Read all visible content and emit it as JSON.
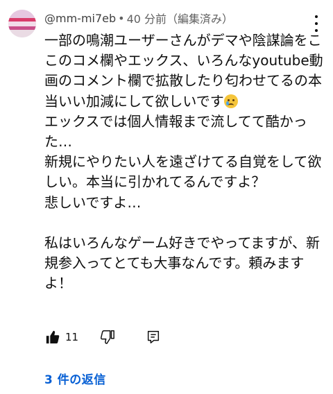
{
  "comment": {
    "handle": "@mm-mi7eb",
    "separator": "•",
    "time": "40 分前（編集済み）",
    "lines": [
      "一部の鳴潮ユーザーさんがデマや陰謀論をこ",
      "このコメ欄やエックス、いろんなyoutube動",
      "画のコメント欄で拡散したり匂わせてるの本",
      "当いい加減にして欲しいです",
      "エックスでは個人情報まで流してて酷かっ",
      "た…",
      "新規にやりたい人を遠ざけてる自覚をして欲",
      "しい。本当に引かれてるんですよ？",
      "悲しいですよ…",
      "",
      "私はいろんなゲーム好きでやってますが、新",
      "規参入ってとても大事なんです。頼みます",
      "よ！"
    ],
    "emoji": "crying-face-emoji"
  },
  "actions": {
    "like_count": "11",
    "icons": [
      "thumbs-up-icon",
      "thumbs-down-icon",
      "reply-icon"
    ]
  },
  "replies": {
    "label": "3 件の返信"
  },
  "colors": {
    "text": "#0f0f0f",
    "meta": "#606060",
    "link": "#065fd4"
  }
}
